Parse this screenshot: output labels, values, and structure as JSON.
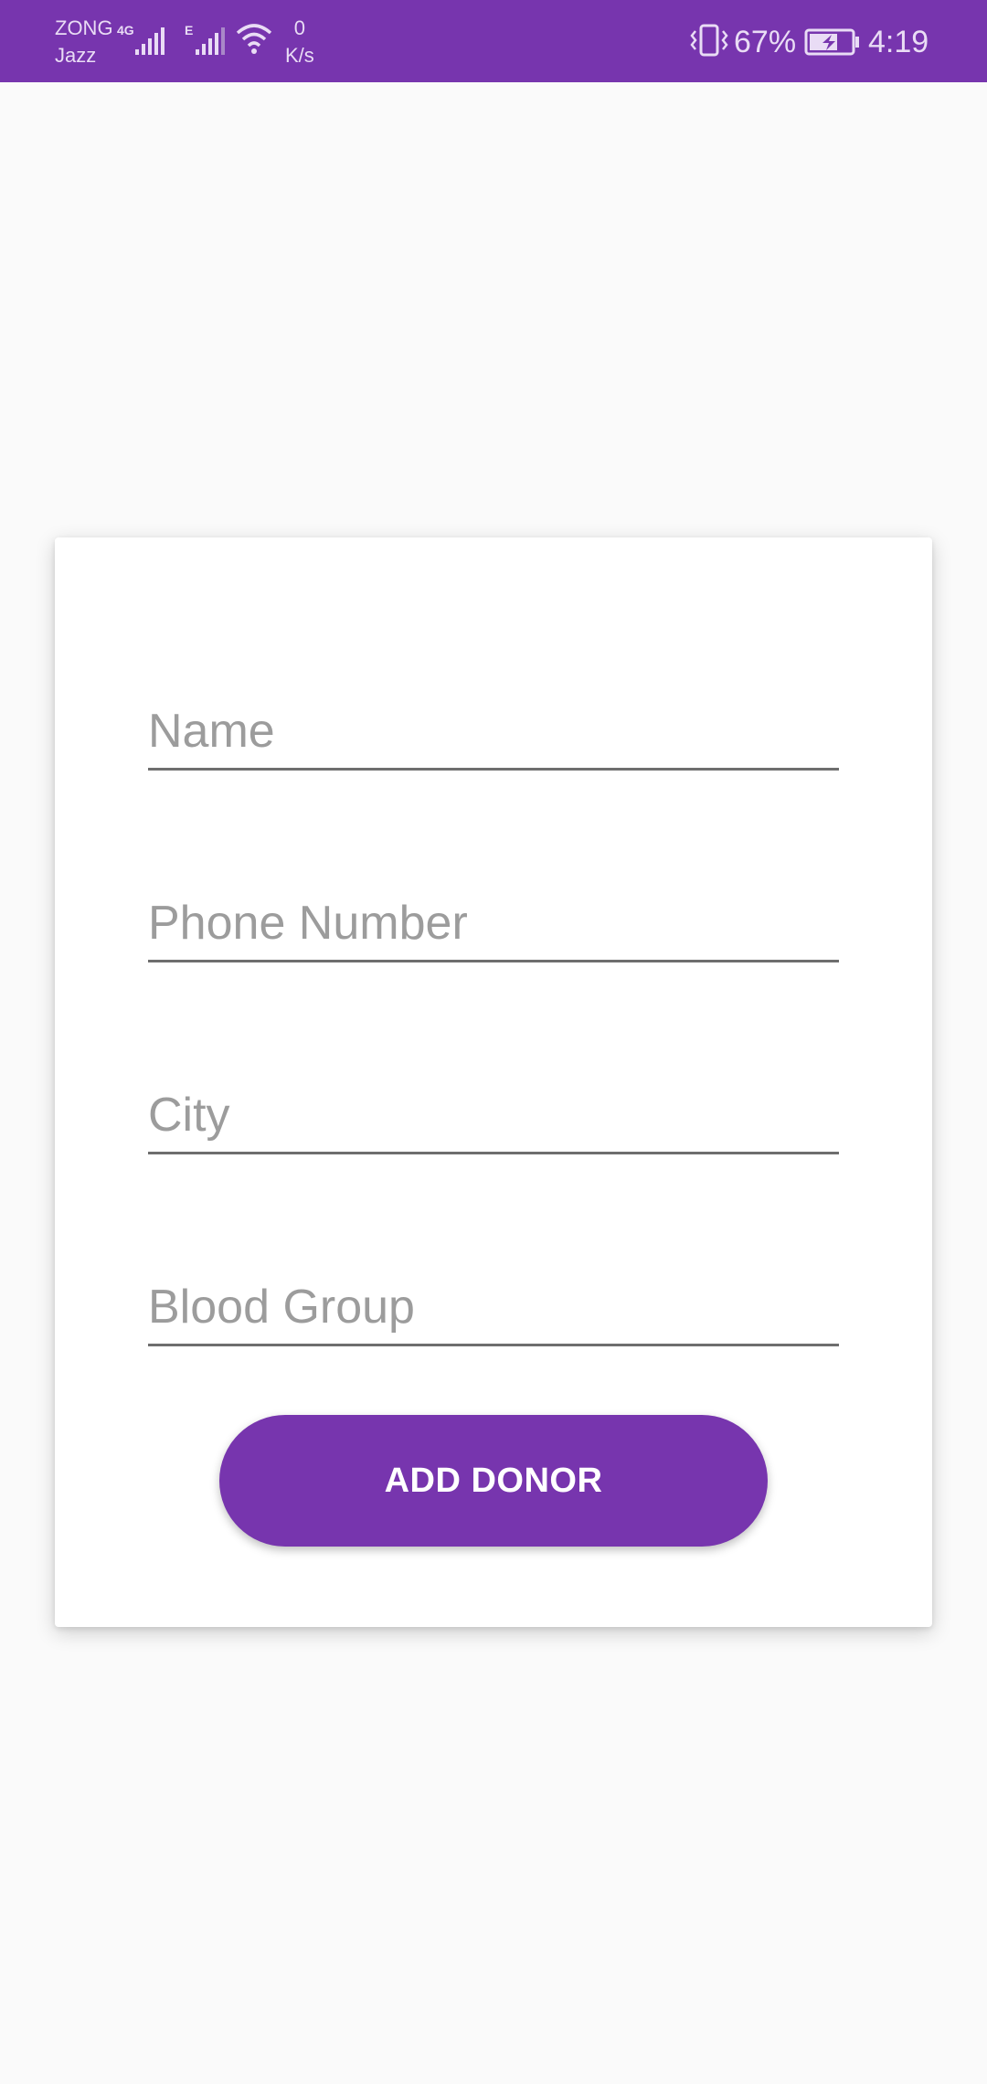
{
  "status_bar": {
    "carrier_primary": "ZONG",
    "carrier_secondary": "Jazz",
    "network_type_1": "4G",
    "network_type_2": "E",
    "net_speed_value": "0",
    "net_speed_unit": "K/s",
    "battery_percent": "67%",
    "time": "4:19",
    "icons": [
      "signal-icon",
      "signal-icon",
      "wifi-icon",
      "vibrate-icon",
      "battery-charging-icon"
    ]
  },
  "form": {
    "name_placeholder": "Name",
    "phone_placeholder": "Phone Number",
    "city_placeholder": "City",
    "blood_group_placeholder": "Blood Group",
    "submit_label": "ADD DONOR"
  },
  "colors": {
    "primary": "#7735ae",
    "background": "#fafafa",
    "card": "#ffffff",
    "hint_text": "#9c9c9c",
    "underline": "#6e6e6e"
  }
}
